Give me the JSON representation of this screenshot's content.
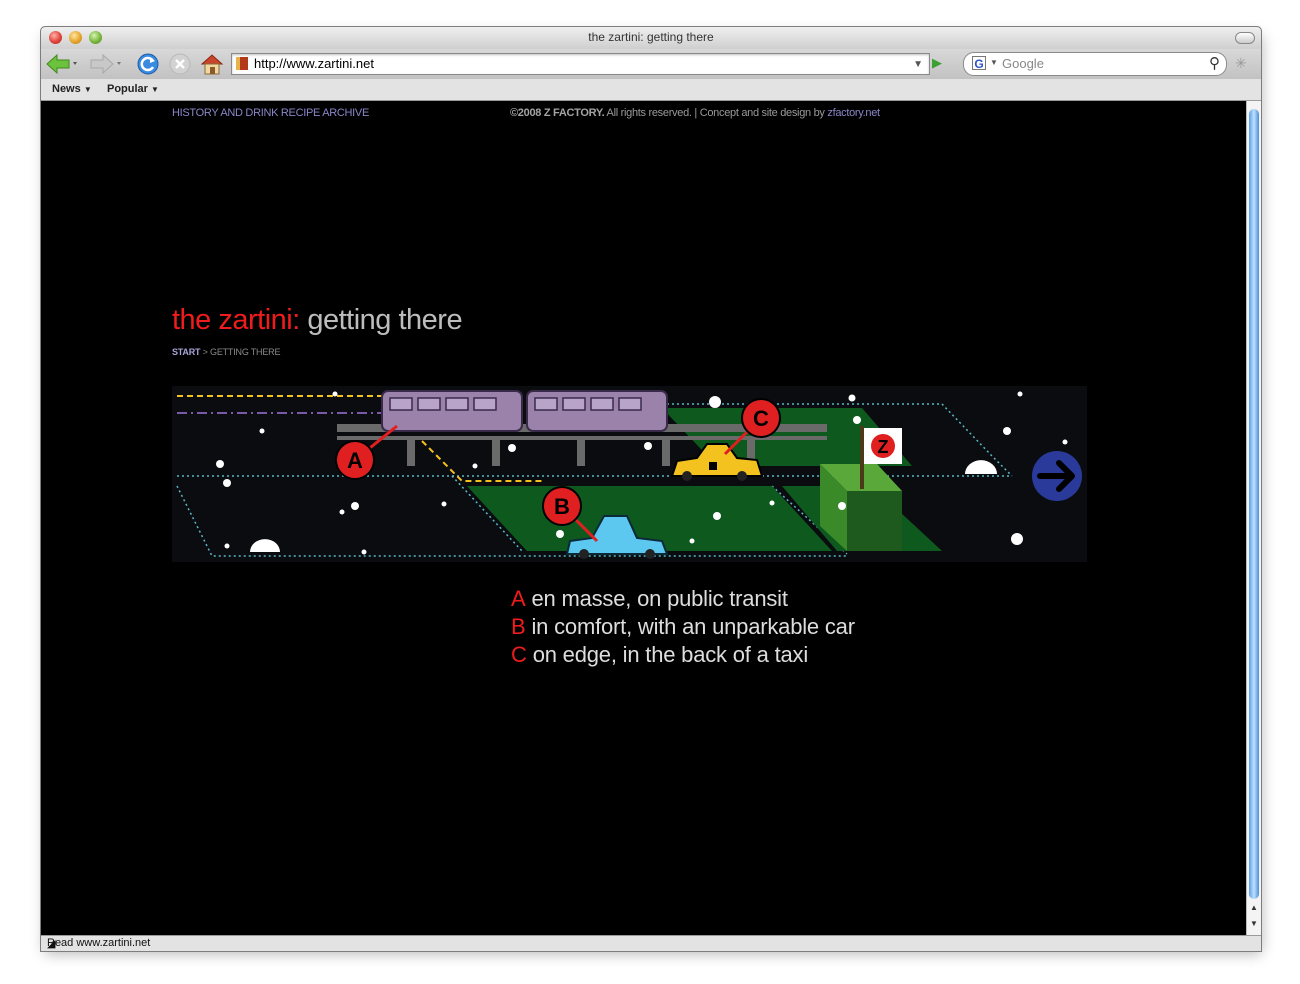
{
  "window": {
    "title": "the zartini: getting there"
  },
  "toolbar": {
    "url": "http://www.zartini.net",
    "search_placeholder": "Google"
  },
  "bookmarks": [
    {
      "label": "News"
    },
    {
      "label": "Popular"
    }
  ],
  "status": {
    "text": "Read www.zartini.net"
  },
  "page": {
    "archive_link": "HISTORY AND DRINK RECIPE ARCHIVE",
    "copyright_brand": "©2008 Z FACTORY.",
    "copyright_text": " All rights reserved. | Concept and site design by ",
    "copyright_link": "zfactory.net",
    "title_red": "the zartini:",
    "title_grey": " getting there",
    "breadcrumb_start": "START",
    "breadcrumb_sep": " > ",
    "breadcrumb_current": "GETTING THERE",
    "markers": {
      "a": "A",
      "b": "B",
      "c": "C",
      "flag": "Z"
    },
    "legend": [
      {
        "key": "A",
        "text": "en masse, on public transit"
      },
      {
        "key": "B",
        "text": "in comfort, with an unparkable car"
      },
      {
        "key": "C",
        "text": "on edge, in the back of a taxi"
      }
    ]
  },
  "colors": {
    "accent_red": "#ee1c1c",
    "link_purple": "#8a86c8",
    "park_green": "#0e5a1e",
    "train_purple": "#9a82aa",
    "taxi_yellow": "#f4c21e",
    "car_blue": "#5cc8f0",
    "next_arrow_blue": "#2a3a9a"
  },
  "icons": [
    "back-arrow-icon",
    "forward-arrow-icon",
    "reload-icon",
    "stop-icon",
    "home-icon",
    "site-favicon-icon",
    "go-icon",
    "google-icon",
    "search-magnifier-icon",
    "next-arrow-icon"
  ]
}
